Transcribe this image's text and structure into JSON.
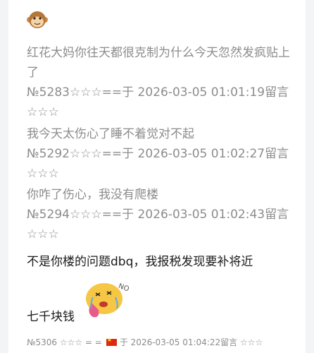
{
  "quotes": [
    {
      "text": "红花大妈你往天都很克制为什么今天忽然发疯贴上了",
      "meta": "№5283☆☆☆==于 2026-03-05 01:01:19留言☆☆☆"
    },
    {
      "text": "我今天太伤心了睡不着觉对不起",
      "meta": "№5292☆☆☆==于 2026-03-05 01:02:27留言☆☆☆"
    },
    {
      "text": "你咋了伤心，我没有爬楼",
      "meta": "№5294☆☆☆==于 2026-03-05 01:02:43留言☆☆☆"
    }
  ],
  "reply": {
    "line1": "不是你楼的问题dbq，我报税发现要补将近",
    "line2": "七千块钱"
  },
  "footer": {
    "number": "№5306 ☆☆☆ = =",
    "flag_icon": "china-flag-icon",
    "timestamp": "于 2026-03-05 01:04:22留言 ☆☆☆"
  },
  "sticker": {
    "text": "NO"
  },
  "icons": {
    "avatar": "monkey-avatar-icon"
  }
}
